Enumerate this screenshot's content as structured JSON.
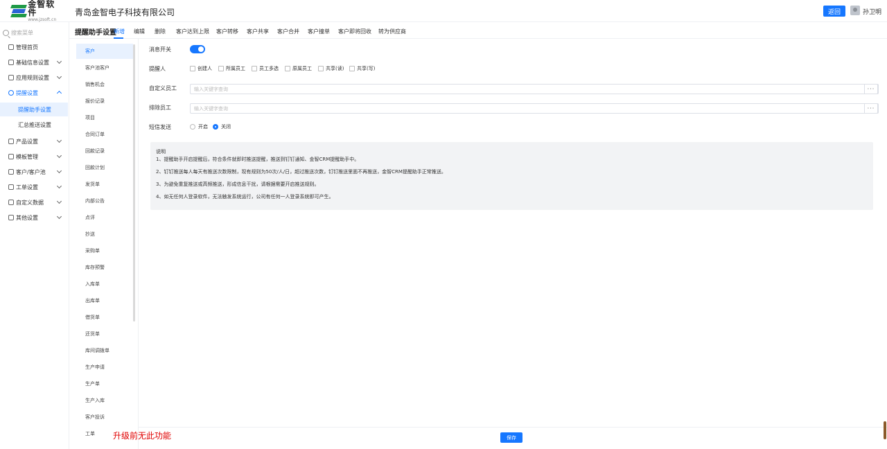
{
  "header": {
    "logo_name": "金智软件",
    "logo_url": "www.jzsoft.cn",
    "company": "青岛金智电子科技有限公司",
    "back_label": "返回",
    "user_name": "孙卫明"
  },
  "leftnav": {
    "search_placeholder": "搜索菜单",
    "items": [
      {
        "label": "管理首页",
        "icon": "home-icon"
      },
      {
        "label": "基础信息设置",
        "icon": "info-icon"
      },
      {
        "label": "应用规则设置",
        "icon": "rules-icon"
      },
      {
        "label": "提醒设置",
        "icon": "bell-icon",
        "open": true
      },
      {
        "label": "产品设置",
        "icon": "product-icon"
      },
      {
        "label": "模板管理",
        "icon": "template-icon"
      },
      {
        "label": "客户/客户池",
        "icon": "customer-icon"
      },
      {
        "label": "工单设置",
        "icon": "ticket-icon"
      },
      {
        "label": "自定义数据",
        "icon": "custom-data-icon"
      },
      {
        "label": "其他设置",
        "icon": "other-icon"
      }
    ],
    "subitems": [
      {
        "label": "提醒助手设置",
        "active": true
      },
      {
        "label": "汇总推送设置"
      }
    ]
  },
  "tabs": {
    "page_title": "提醒助手设置",
    "items": [
      "新增",
      "编辑",
      "删除",
      "客户达到上限",
      "客户转移",
      "客户共享",
      "客户合并",
      "客户撞单",
      "客户即将回收",
      "转为供应商"
    ],
    "active_index": 0
  },
  "sublist": {
    "items": [
      "客户",
      "客户池客户",
      "销售机会",
      "报价记录",
      "项目",
      "合同订单",
      "回款记录",
      "回款计划",
      "发货单",
      "内部公告",
      "点评",
      "抄送",
      "采购单",
      "库存预警",
      "入库单",
      "出库单",
      "借货单",
      "还货单",
      "库间调拨单",
      "生产申请",
      "生产单",
      "生产入库",
      "客户投诉",
      "工单"
    ],
    "active_index": 0
  },
  "form": {
    "switch_label": "消息开关",
    "switch_on": true,
    "reminder_label": "提醒人",
    "reminder_options": [
      "创建人",
      "所属员工",
      "员工多选",
      "原属员工",
      "共享(读)",
      "共享(写)"
    ],
    "custom_staff_label": "自定义员工",
    "custom_staff_placeholder": "输入关键字查询",
    "exclude_staff_label": "排除员工",
    "exclude_staff_placeholder": "输入关键字查询",
    "more_label": "···",
    "sms_label": "短信发送",
    "sms_options": [
      "开启",
      "关闭"
    ],
    "sms_selected": "关闭"
  },
  "note": {
    "title": "说明",
    "lines": [
      "1、提醒助手开启提醒后，符合条件就即时推送提醒，推送到钉钉通知、金智CRM提醒助手中。",
      "2、钉钉推送每人每天有推送次数限制，现有规则为50次/人/日，超过推送次数，钉钉推送里面不再推送，金智CRM提醒助手正常推送。",
      "3、为避免重复推送或高频推送，形成信息干扰，请根据需要开启推送规则。",
      "4、如无任何人登录软件，无法触发系统运行，公司有任何一人登录系统即可产生。"
    ]
  },
  "footer": {
    "save_label": "保存"
  },
  "overlay": {
    "text": "升级前无此功能"
  },
  "colors": {
    "accent": "#1677ff",
    "overlay_text": "#e00000"
  }
}
